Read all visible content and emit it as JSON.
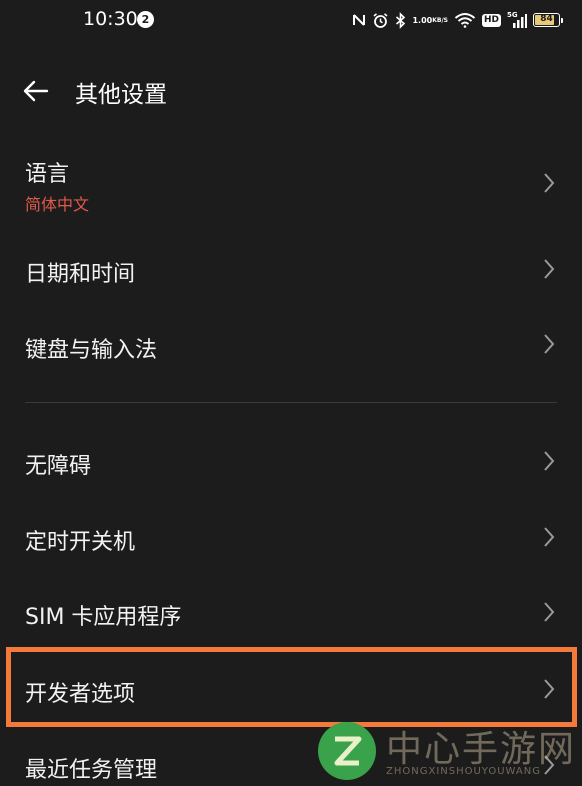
{
  "status_bar": {
    "time": "10:30",
    "notification_count": "2",
    "net_speed_value": "1.00",
    "net_speed_unit": "KB/S",
    "hd_label": "HD",
    "network_label": "5G",
    "battery_level": "84",
    "battery_fraction": 0.84,
    "battery_color": "#e8c978"
  },
  "header": {
    "title": "其他设置"
  },
  "settings": {
    "language": {
      "label": "语言",
      "value": "简体中文"
    },
    "datetime": {
      "label": "日期和时间"
    },
    "keyboard": {
      "label": "键盘与输入法"
    },
    "accessibility": {
      "label": "无障碍"
    },
    "scheduled_power": {
      "label": "定时开关机"
    },
    "sim_apps": {
      "label": "SIM 卡应用程序"
    },
    "developer": {
      "label": "开发者选项"
    },
    "recent_tasks": {
      "label": "最近任务管理"
    }
  },
  "colors": {
    "background": "#1c1c1c",
    "accent_value_text": "#e05a4a",
    "highlight_border": "#f47a3c"
  },
  "watermark": {
    "main_text": "中心手游网",
    "sub_text": "ZHONGXINSHOUYOUWANG"
  }
}
